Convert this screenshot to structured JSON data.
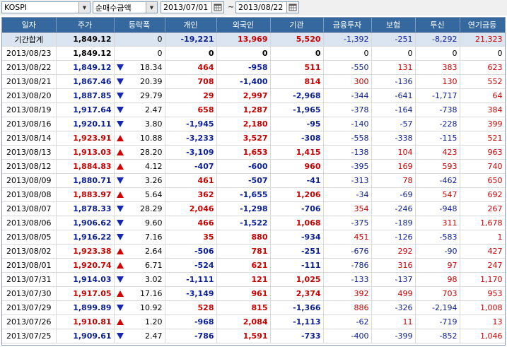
{
  "toolbar": {
    "market": "KOSPI",
    "metric": "순매수금액",
    "start_date": "2013/07/01",
    "separator": "~",
    "end_date": "2013/08/22"
  },
  "colors": {
    "header_bg": "#34689e",
    "up": "#c80000",
    "down": "#0a1e96",
    "summary_bg": "#dbe5f1"
  },
  "table": {
    "headers": [
      "일자",
      "주가",
      "등락폭",
      "개인",
      "외국인",
      "기관",
      "금융투자",
      "보험",
      "투신",
      "연기금등"
    ],
    "rows": [
      {
        "date": "기간합계",
        "price": "1,849.12",
        "dir": "",
        "chg": "0",
        "ind": "-19,221",
        "frg": "13,969",
        "inst": "5,520",
        "fin": "-1,392",
        "ins": "-251",
        "trust": "-8,292",
        "pen": "21,323",
        "pc": "blk",
        "sum": true
      },
      {
        "date": "2013/08/23",
        "price": "1,849.12",
        "dir": "",
        "chg": "0",
        "ind": "0",
        "frg": "0",
        "inst": "0",
        "fin": "0",
        "ins": "0",
        "trust": "0",
        "pen": "0",
        "pc": "blk"
      },
      {
        "date": "2013/08/22",
        "price": "1,849.12",
        "dir": "down",
        "chg": "18.34",
        "ind": "464",
        "frg": "-958",
        "inst": "511",
        "fin": "-550",
        "ins": "131",
        "trust": "383",
        "pen": "623",
        "pc": "blue"
      },
      {
        "date": "2013/08/21",
        "price": "1,867.46",
        "dir": "down",
        "chg": "20.39",
        "ind": "708",
        "frg": "-1,400",
        "inst": "814",
        "fin": "300",
        "ins": "-136",
        "trust": "130",
        "pen": "552",
        "pc": "blue"
      },
      {
        "date": "2013/08/20",
        "price": "1,887.85",
        "dir": "down",
        "chg": "29.79",
        "ind": "29",
        "frg": "2,997",
        "inst": "-2,968",
        "fin": "-344",
        "ins": "-641",
        "trust": "-1,717",
        "pen": "64",
        "pc": "blue"
      },
      {
        "date": "2013/08/19",
        "price": "1,917.64",
        "dir": "down",
        "chg": "2.47",
        "ind": "658",
        "frg": "1,287",
        "inst": "-1,965",
        "fin": "-378",
        "ins": "-164",
        "trust": "-738",
        "pen": "384",
        "pc": "blue"
      },
      {
        "date": "2013/08/16",
        "price": "1,920.11",
        "dir": "down",
        "chg": "3.80",
        "ind": "-1,945",
        "frg": "2,180",
        "inst": "-95",
        "fin": "-140",
        "ins": "-57",
        "trust": "-228",
        "pen": "399",
        "pc": "blue"
      },
      {
        "date": "2013/08/14",
        "price": "1,923.91",
        "dir": "up",
        "chg": "10.88",
        "ind": "-3,233",
        "frg": "3,527",
        "inst": "-308",
        "fin": "-558",
        "ins": "-338",
        "trust": "-115",
        "pen": "521",
        "pc": "red"
      },
      {
        "date": "2013/08/13",
        "price": "1,913.03",
        "dir": "up",
        "chg": "28.20",
        "ind": "-3,109",
        "frg": "1,653",
        "inst": "1,415",
        "fin": "-138",
        "ins": "104",
        "trust": "423",
        "pen": "963",
        "pc": "red"
      },
      {
        "date": "2013/08/12",
        "price": "1,884.83",
        "dir": "up",
        "chg": "4.12",
        "ind": "-407",
        "frg": "-600",
        "inst": "960",
        "fin": "-395",
        "ins": "169",
        "trust": "593",
        "pen": "740",
        "pc": "red"
      },
      {
        "date": "2013/08/09",
        "price": "1,880.71",
        "dir": "down",
        "chg": "3.26",
        "ind": "461",
        "frg": "-507",
        "inst": "-41",
        "fin": "-313",
        "ins": "78",
        "trust": "-462",
        "pen": "650",
        "pc": "blue"
      },
      {
        "date": "2013/08/08",
        "price": "1,883.97",
        "dir": "up",
        "chg": "5.64",
        "ind": "362",
        "frg": "-1,655",
        "inst": "1,206",
        "fin": "-34",
        "ins": "-69",
        "trust": "547",
        "pen": "692",
        "pc": "red"
      },
      {
        "date": "2013/08/07",
        "price": "1,878.33",
        "dir": "down",
        "chg": "28.29",
        "ind": "2,046",
        "frg": "-1,298",
        "inst": "-706",
        "fin": "354",
        "ins": "-246",
        "trust": "-948",
        "pen": "267",
        "pc": "blue"
      },
      {
        "date": "2013/08/06",
        "price": "1,906.62",
        "dir": "down",
        "chg": "9.60",
        "ind": "466",
        "frg": "-1,522",
        "inst": "1,068",
        "fin": "-375",
        "ins": "-189",
        "trust": "311",
        "pen": "1,678",
        "pc": "blue"
      },
      {
        "date": "2013/08/05",
        "price": "1,916.22",
        "dir": "down",
        "chg": "7.16",
        "ind": "35",
        "frg": "880",
        "inst": "-934",
        "fin": "451",
        "ins": "-126",
        "trust": "-583",
        "pen": "1",
        "pc": "blue"
      },
      {
        "date": "2013/08/02",
        "price": "1,923.38",
        "dir": "up",
        "chg": "2.64",
        "ind": "-506",
        "frg": "781",
        "inst": "-251",
        "fin": "-676",
        "ins": "292",
        "trust": "-90",
        "pen": "427",
        "pc": "red"
      },
      {
        "date": "2013/08/01",
        "price": "1,920.74",
        "dir": "up",
        "chg": "6.71",
        "ind": "-524",
        "frg": "621",
        "inst": "-111",
        "fin": "-786",
        "ins": "316",
        "trust": "97",
        "pen": "247",
        "pc": "red"
      },
      {
        "date": "2013/07/31",
        "price": "1,914.03",
        "dir": "down",
        "chg": "3.02",
        "ind": "-1,111",
        "frg": "121",
        "inst": "1,025",
        "fin": "-133",
        "ins": "-137",
        "trust": "98",
        "pen": "1,170",
        "pc": "blue"
      },
      {
        "date": "2013/07/30",
        "price": "1,917.05",
        "dir": "up",
        "chg": "17.16",
        "ind": "-3,149",
        "frg": "961",
        "inst": "2,374",
        "fin": "392",
        "ins": "499",
        "trust": "703",
        "pen": "953",
        "pc": "red"
      },
      {
        "date": "2013/07/29",
        "price": "1,899.89",
        "dir": "down",
        "chg": "10.92",
        "ind": "528",
        "frg": "815",
        "inst": "-1,366",
        "fin": "886",
        "ins": "-326",
        "trust": "-2,194",
        "pen": "1,008",
        "pc": "blue"
      },
      {
        "date": "2013/07/26",
        "price": "1,910.81",
        "dir": "up",
        "chg": "1.20",
        "ind": "-968",
        "frg": "2,084",
        "inst": "-1,113",
        "fin": "-62",
        "ins": "11",
        "trust": "-719",
        "pen": "13",
        "pc": "red"
      },
      {
        "date": "2013/07/25",
        "price": "1,909.61",
        "dir": "down",
        "chg": "2.47",
        "ind": "-786",
        "frg": "1,591",
        "inst": "-733",
        "fin": "-400",
        "ins": "-399",
        "trust": "-852",
        "pen": "1,046",
        "pc": "blue"
      }
    ]
  }
}
